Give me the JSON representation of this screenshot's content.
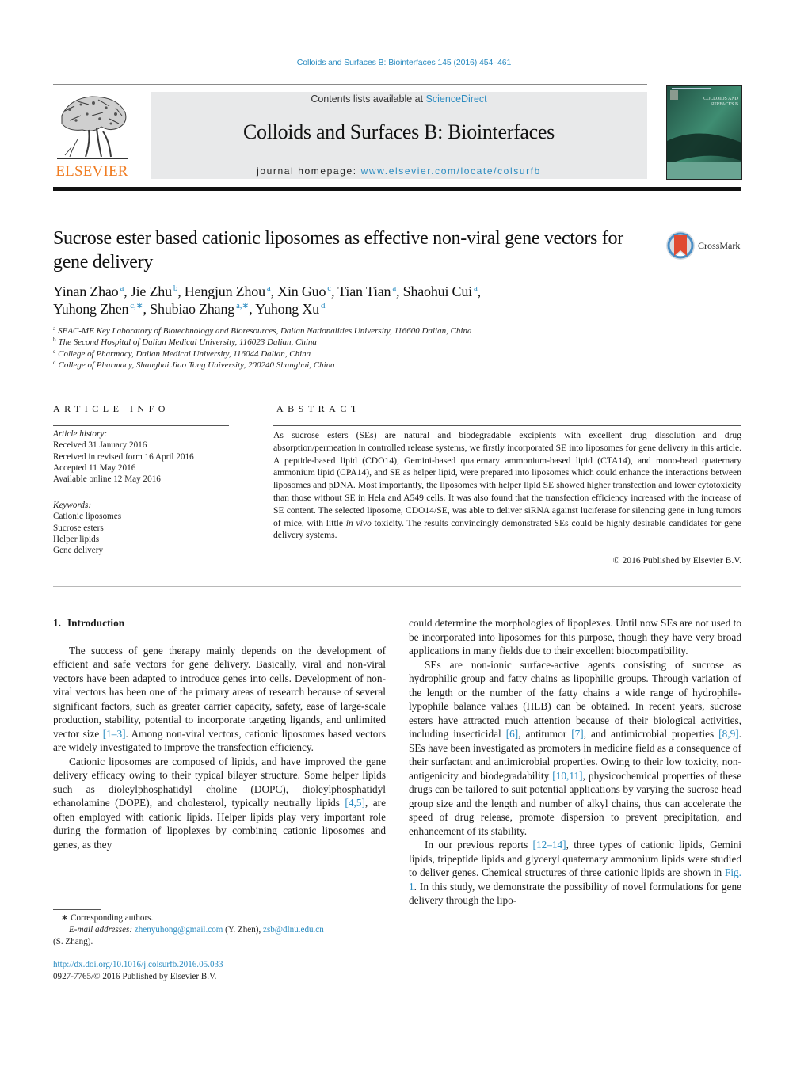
{
  "header": {
    "citation": "Colloids and Surfaces B: Biointerfaces 145 (2016) 454–461",
    "contents_prefix": "Contents lists available at ",
    "contents_link": "ScienceDirect",
    "journal_title": "Colloids and Surfaces B: Biointerfaces",
    "homepage_prefix": "journal homepage: ",
    "homepage_link": "www.elsevier.com/locate/colsurfb",
    "publisher_logo_text": "ELSEVIER",
    "cover_title_line1": "COLLOIDS AND",
    "cover_title_line2": "SURFACES B",
    "crossmark_label": "CrossMark"
  },
  "colors": {
    "link": "#2a8bc0",
    "elsevier_orange": "#f07c21",
    "masthead_bg": "#e8e9ea",
    "cover_green": "#2e6b5a"
  },
  "article": {
    "title": "Sucrose ester based cationic liposomes as effective non-viral gene vectors for gene delivery",
    "authors": [
      {
        "name": "Yinan Zhao",
        "sup": "a",
        "sep": ", "
      },
      {
        "name": "Jie Zhu",
        "sup": "b",
        "sep": ", "
      },
      {
        "name": "Hengjun Zhou",
        "sup": "a",
        "sep": ", "
      },
      {
        "name": "Xin Guo",
        "sup": "c",
        "sep": ", "
      },
      {
        "name": "Tian Tian",
        "sup": "a",
        "sep": ", "
      },
      {
        "name": "Shaohui Cui",
        "sup": "a",
        "sep": ","
      },
      {
        "name": "Yuhong Zhen",
        "sup": "c,∗",
        "sep": ", "
      },
      {
        "name": "Shubiao Zhang",
        "sup": "a,∗",
        "sep": ", "
      },
      {
        "name": "Yuhong Xu",
        "sup": "d",
        "sep": ""
      }
    ],
    "affiliations": [
      {
        "key": "a",
        "text": "SEAC-ME Key Laboratory of Biotechnology and Bioresources, Dalian Nationalities University, 116600 Dalian, China"
      },
      {
        "key": "b",
        "text": "The Second Hospital of Dalian Medical University, 116023 Dalian, China"
      },
      {
        "key": "c",
        "text": "College of Pharmacy, Dalian Medical University, 116044 Dalian, China"
      },
      {
        "key": "d",
        "text": "College of Pharmacy, Shanghai Jiao Tong University, 200240 Shanghai, China"
      }
    ]
  },
  "article_info": {
    "heading": "ARTICLE INFO",
    "history_label": "Article history:",
    "history": [
      "Received 31 January 2016",
      "Received in revised form 16 April 2016",
      "Accepted 11 May 2016",
      "Available online 12 May 2016"
    ],
    "keywords_label": "Keywords:",
    "keywords": [
      "Cationic liposomes",
      "Sucrose esters",
      "Helper lipids",
      "Gene delivery"
    ]
  },
  "abstract": {
    "heading": "ABSTRACT",
    "text_part1": "As sucrose esters (SEs) are natural and biodegradable excipients with excellent drug dissolution and drug absorption/permeation in controlled release systems, we firstly incorporated SE into liposomes for gene delivery in this article. A peptide-based lipid (CDO14), Gemini-based quaternary ammonium-based lipid (CTA14), and mono-head quaternary ammonium lipid (CPA14), and SE as helper lipid, were prepared into liposomes which could enhance the interactions between liposomes and pDNA. Most importantly, the liposomes with helper lipid SE showed higher transfection and lower cytotoxicity than those without SE in Hela and A549 cells. It was also found that the transfection efficiency increased with the increase of SE content. The selected liposome, CDO14/SE, was able to deliver siRNA against luciferase for silencing gene in lung tumors of mice, with little ",
    "text_italic": "in vivo",
    "text_part2": " toxicity. The results convincingly demonstrated SEs could be highly desirable candidates for gene delivery systems.",
    "copyright": "© 2016 Published by Elsevier B.V."
  },
  "body": {
    "section1": {
      "number": "1.",
      "title": "Introduction"
    },
    "left": {
      "p1_a": "The success of gene therapy mainly depends on the development of efficient and safe vectors for gene delivery. Basically, viral and non-viral vectors have been adapted to introduce genes into cells. Development of non-viral vectors has been one of the primary areas of research because of several significant factors, such as greater carrier capacity, safety, ease of large-scale production, stability, potential to incorporate targeting ligands, and unlimited vector size ",
      "p1_ref": "[1–3]",
      "p1_b": ". Among non-viral vectors, cationic liposomes based vectors are widely investigated to improve the transfection efficiency.",
      "p2_a": "Cationic liposomes are composed of lipids, and have improved the gene delivery efficacy owing to their typical bilayer structure. Some helper lipids such as dioleylphosphatidyl choline (DOPC), dioleylphosphatidyl ethanolamine (DOPE), and cholesterol, typically neutrally lipids ",
      "p2_ref": "[4,5]",
      "p2_b": ", are often employed with cationic lipids. Helper lipids play very important role during the formation of lipoplexes by combining cationic liposomes and genes, as they"
    },
    "right": {
      "p0": "could determine the morphologies of lipoplexes. Until now SEs are not used to be incorporated into liposomes for this purpose, though they have very broad applications in many fields due to their excellent biocompatibility.",
      "p1_a": "SEs are non-ionic surface-active agents consisting of sucrose as hydrophilic group and fatty chains as lipophilic groups. Through variation of the length or the number of the fatty chains a wide range of hydrophile-lypophile balance values (HLB) can be obtained. In recent years, sucrose esters have attracted much attention because of their biological activities, including insecticidal ",
      "p1_ref1": "[6]",
      "p1_b": ", antitumor ",
      "p1_ref2": "[7]",
      "p1_c": ", and antimicrobial properties ",
      "p1_ref3": "[8,9]",
      "p1_d": ". SEs have been investigated as promoters in medicine field as a consequence of their surfactant and antimicrobial properties. Owing to their low toxicity, non-antigenicity and biodegradability ",
      "p1_ref4": "[10,11]",
      "p1_e": ", physicochemical properties of these drugs can be tailored to suit potential applications by varying the sucrose head group size and the length and number of alkyl chains, thus can accelerate the speed of drug release, promote dispersion to prevent precipitation, and enhancement of its stability.",
      "p2_a": "In our previous reports ",
      "p2_ref1": "[12–14]",
      "p2_b": ", three types of cationic lipids, Gemini lipids, tripeptide lipids and glyceryl quaternary ammonium lipids were studied to deliver genes. Chemical structures of three cationic lipids are shown in ",
      "p2_ref2": "Fig. 1",
      "p2_c": ". In this study, we demonstrate the possibility of novel formulations for gene delivery through the lipo-"
    }
  },
  "footnotes": {
    "star": "∗",
    "corresponding": "Corresponding authors.",
    "email_label": "E-mail addresses:",
    "email1": "zhenyuhong@gmail.com",
    "email1_owner": " (Y. Zhen), ",
    "email2": "zsb@dlnu.edu.cn",
    "email2_owner": "(S. Zhang).",
    "doi": "http://dx.doi.org/10.1016/j.colsurfb.2016.05.033",
    "issn": "0927-7765/© 2016 Published by Elsevier B.V."
  }
}
